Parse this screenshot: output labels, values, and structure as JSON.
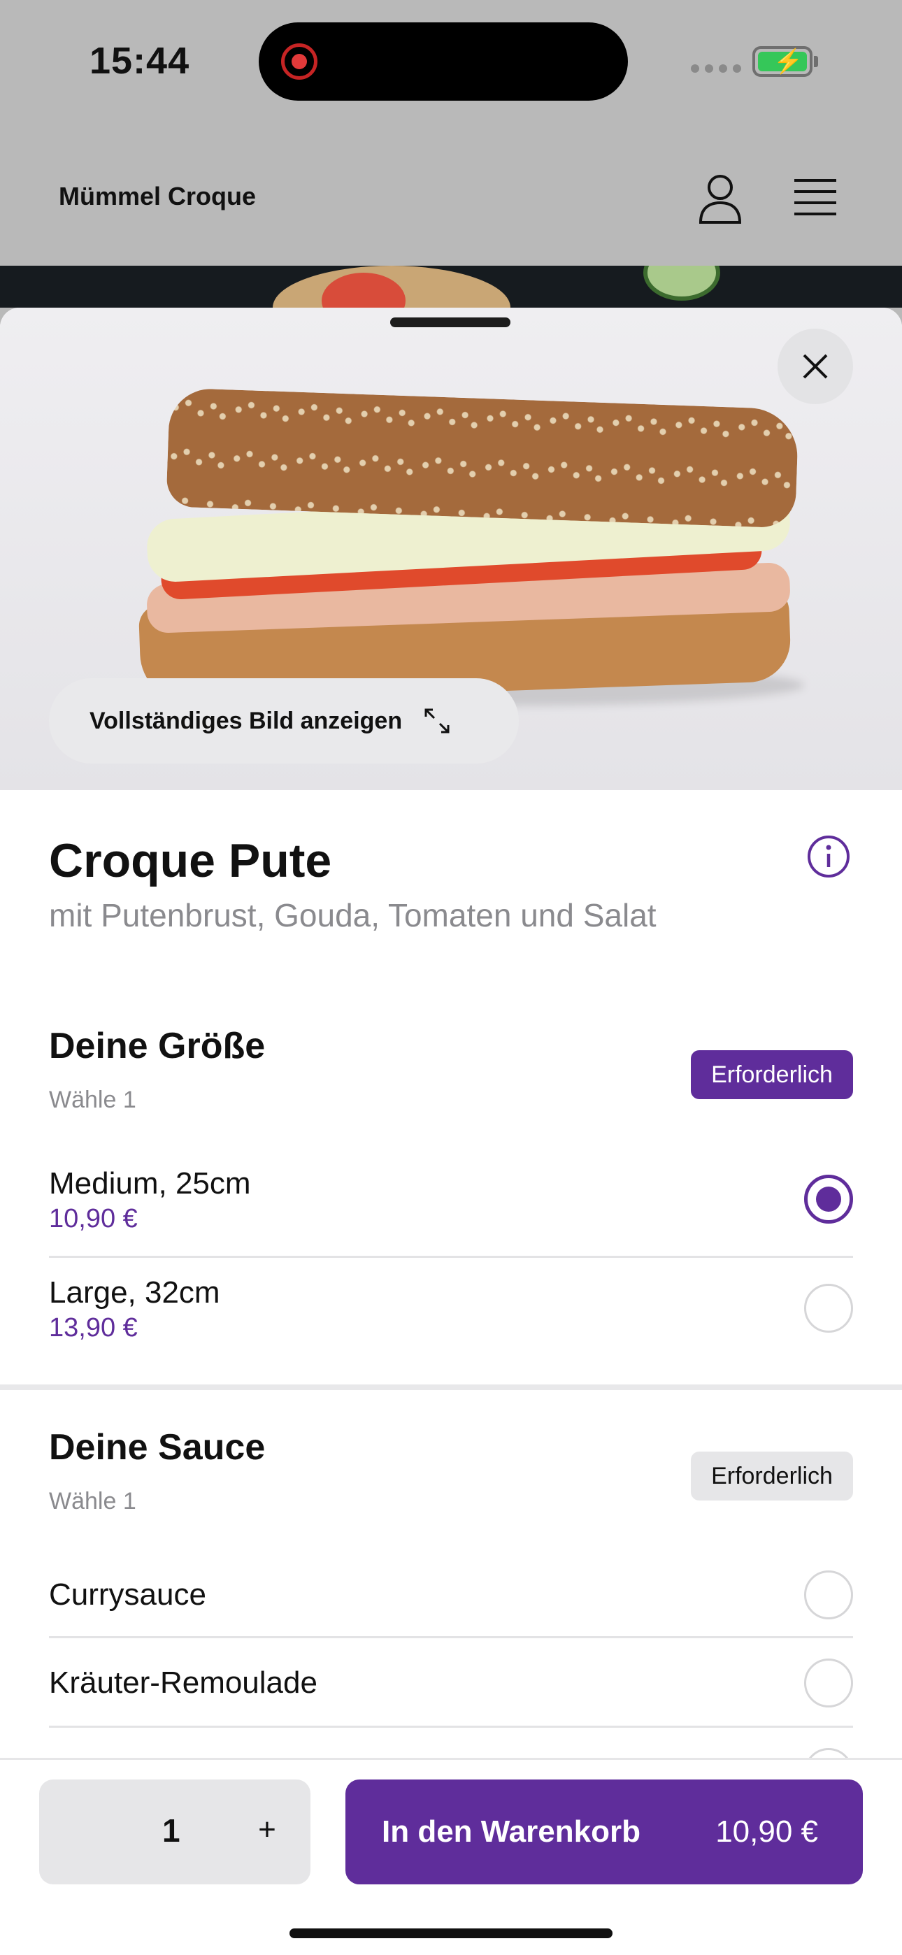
{
  "status_bar": {
    "time": "15:44"
  },
  "header": {
    "brand": "Mümmel Croque"
  },
  "hero": {
    "view_image_label": "Vollständiges Bild anzeigen"
  },
  "product": {
    "title": "Croque Pute",
    "subtitle": "mit Putenbrust, Gouda, Tomaten und Salat"
  },
  "size_section": {
    "title": "Deine Größe",
    "subtitle": "Wähle 1",
    "badge": "Erforderlich",
    "options": [
      {
        "name": "Medium, 25cm",
        "price": "10,90 €",
        "selected": true
      },
      {
        "name": "Large, 32cm",
        "price": "13,90 €",
        "selected": false
      }
    ]
  },
  "sauce_section": {
    "title": "Deine Sauce",
    "subtitle": "Wähle 1",
    "badge": "Erforderlich",
    "options": [
      {
        "name": "Currysauce",
        "selected": false
      },
      {
        "name": "Kräuter-Remoulade",
        "selected": false
      }
    ]
  },
  "footer": {
    "quantity": "1",
    "plus_label": "+",
    "add_to_cart_label": "In den Warenkorb",
    "add_to_cart_price": "10,90 €"
  },
  "colors": {
    "accent": "#5f2d9b"
  },
  "icons": [
    "user-icon",
    "menu-icon",
    "close-icon",
    "expand-icon",
    "info-icon",
    "record-icon",
    "battery-icon"
  ]
}
